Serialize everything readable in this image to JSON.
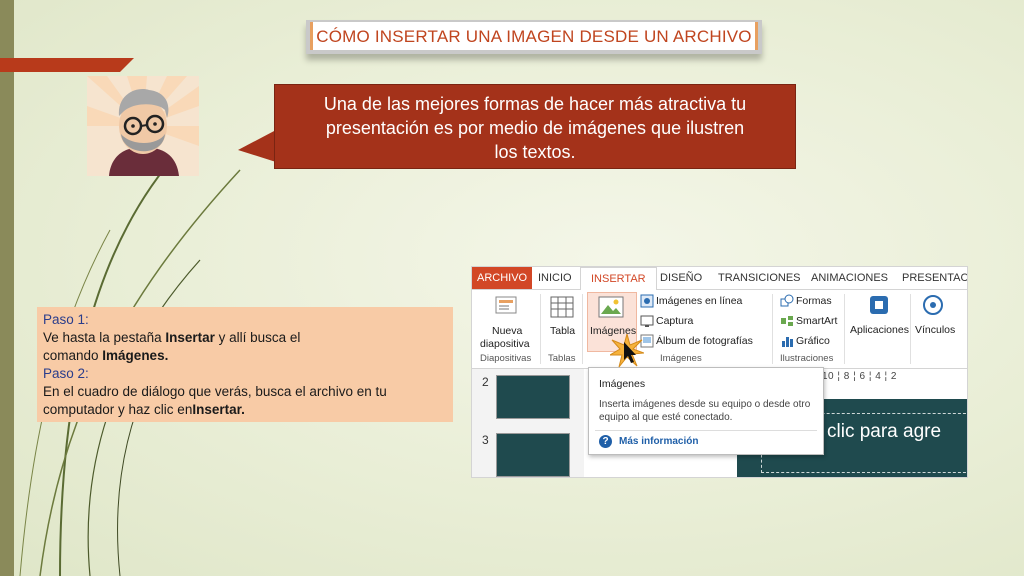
{
  "slide": {
    "title": "CÓMO INSERTAR UNA IMAGEN DESDE UN ARCHIVO",
    "bubble_text_1": "Una de las mejores formas de hacer más atractiva tu",
    "bubble_text_2": "presentación es por medio de imágenes que ilustren",
    "bubble_text_3": "los textos.",
    "steps": {
      "paso1_label": "Paso 1:",
      "paso1_a": "Ve hasta la pestaña ",
      "paso1_b": "Insertar",
      "paso1_c": " y allí busca el",
      "paso1_d": "comando ",
      "paso1_e": "Imágenes.",
      "paso2_label": "Paso 2:",
      "paso2_a": "En el cuadro de diálogo que verás, busca el archivo en tu",
      "paso2_b": "computador y haz clic en",
      "paso2_c": "Insertar."
    }
  },
  "screenshot": {
    "tabs": [
      "ARCHIVO",
      "INICIO",
      "INSERTAR",
      "DISEÑO",
      "TRANSICIONES",
      "ANIMACIONES",
      "PRESENTACIÓ"
    ],
    "ribbon": {
      "nueva": "Nueva",
      "diapositiva": "diapositiva",
      "tabla": "Tabla",
      "imagenes": "Imágenes",
      "imagenes_linea": "Imágenes en línea",
      "captura": "Captura",
      "album": "Álbum de fotografías",
      "formas": "Formas",
      "smartart": "SmartArt",
      "grafico": "Gráfico",
      "aplicaciones": "Aplicaciones",
      "vinculos": "Vínculos",
      "group_diapositivas": "Diapositivas",
      "group_tablas": "Tablas",
      "group_imagenes": "Imágenes",
      "group_ilustraciones": "Ilustraciones"
    },
    "slide_numbers": [
      "2",
      "3"
    ],
    "ruler": "10 ¦ 8 ¦ 6 ¦ 4 ¦ 2",
    "canvas_text": "clic para agre",
    "tooltip": {
      "title": "Imágenes",
      "desc": "Inserta imágenes desde su equipo o desde otro equipo al que esté conectado.",
      "more": "Más información"
    }
  },
  "colors": {
    "accent": "#a4321a",
    "title": "#c0451f",
    "steps_bg": "#f8cba6",
    "office_red": "#d24726"
  }
}
